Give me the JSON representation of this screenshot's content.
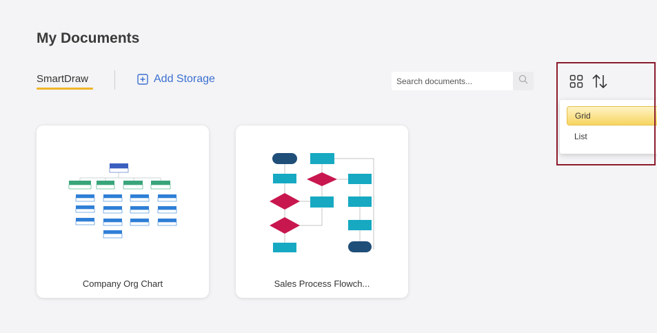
{
  "page": {
    "title": "My Documents"
  },
  "tabs": {
    "smartdraw_label": "SmartDraw",
    "add_storage_label": "Add Storage"
  },
  "search": {
    "placeholder": "Search documents..."
  },
  "view_menu": {
    "items": [
      {
        "label": "Grid",
        "selected": true
      },
      {
        "label": "List",
        "selected": false
      }
    ]
  },
  "documents": [
    {
      "title": "Company Org Chart",
      "thumbnail": "org-chart-diagram"
    },
    {
      "title": "Sales Process Flowch...",
      "thumbnail": "flowchart-diagram"
    }
  ],
  "colors": {
    "accent_tab": "#f0b429",
    "link": "#3b6fd1",
    "highlight_frame": "#8b1a2b",
    "selected_item": "#f7d561"
  }
}
